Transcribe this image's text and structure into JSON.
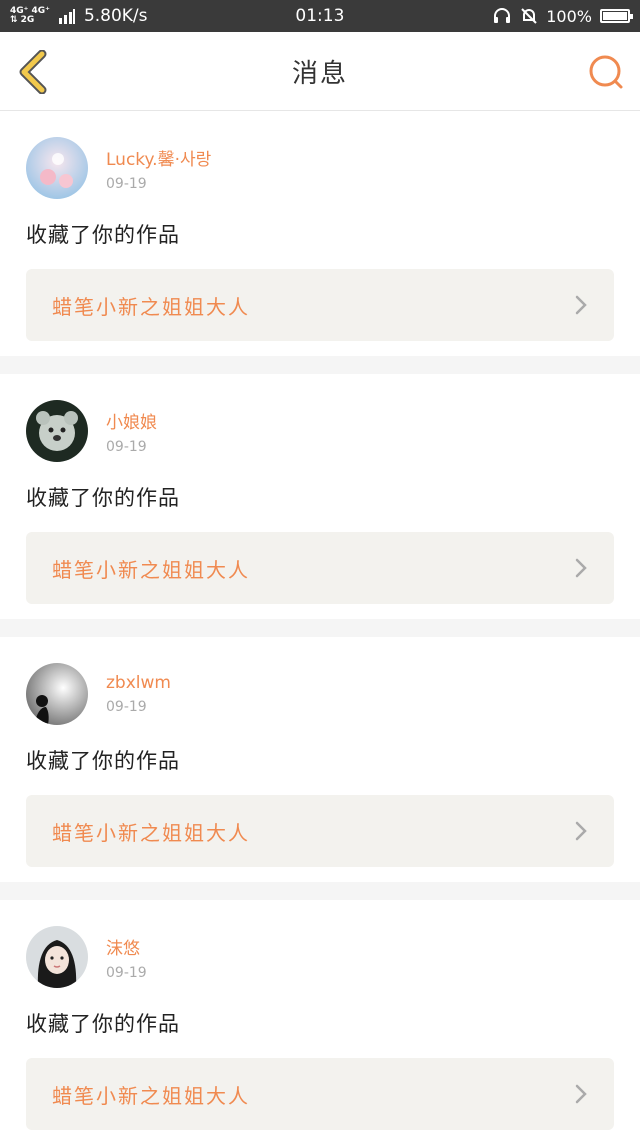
{
  "status_bar": {
    "network_top": "4G⁺ 4G⁺",
    "network_bottom": "⇅ 2G",
    "speed": "5.80K/s",
    "time": "01:13",
    "battery": "100%"
  },
  "header": {
    "title": "消息"
  },
  "messages": [
    {
      "name": "Lucky.馨·사랑",
      "date": "09-19",
      "action": "收藏了你的作品",
      "work": "蜡笔小新之姐姐大人"
    },
    {
      "name": "小娘娘",
      "date": "09-19",
      "action": "收藏了你的作品",
      "work": "蜡笔小新之姐姐大人"
    },
    {
      "name": "zbxlwm",
      "date": "09-19",
      "action": "收藏了你的作品",
      "work": "蜡笔小新之姐姐大人"
    },
    {
      "name": "沫悠",
      "date": "09-19",
      "action": "收藏了你的作品",
      "work": "蜡笔小新之姐姐大人"
    }
  ],
  "colors": {
    "accent": "#f08a50",
    "back_arrow": "#f2c94c",
    "card_bg": "#f3f2ee"
  }
}
